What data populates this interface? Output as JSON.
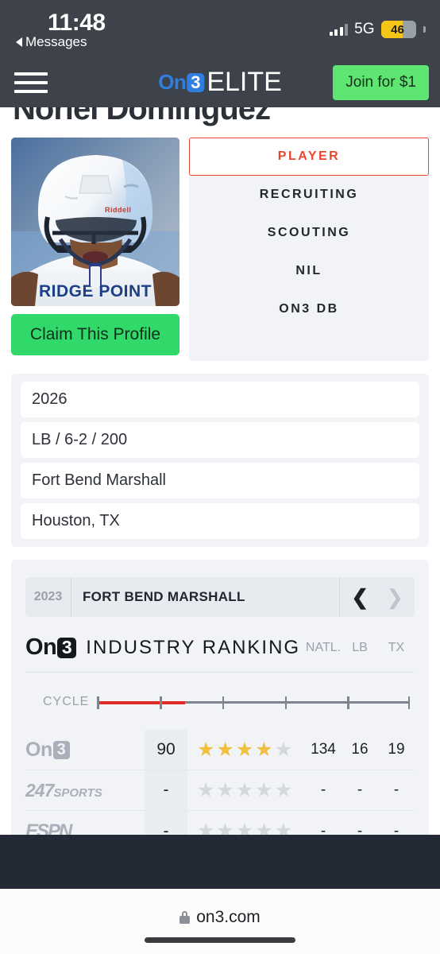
{
  "status_bar": {
    "time": "11:48",
    "back_label": "Messages",
    "network": "5G",
    "battery_level": "46"
  },
  "site_header": {
    "brand_on": "On",
    "brand_three": "3",
    "brand_elite": "ELITE",
    "join_label": "Join for $1",
    "menu_icon": "hamburger-menu-icon"
  },
  "player": {
    "name": "Noriel Dominguez",
    "claim_label": "Claim This Profile",
    "photo_alt": "player-helmet-photo",
    "jersey_text": "RIDGE POINT",
    "helmet_brand": "Riddell"
  },
  "nav_tabs": [
    {
      "label": "PLAYER",
      "active": true
    },
    {
      "label": "RECRUITING",
      "active": false
    },
    {
      "label": "SCOUTING",
      "active": false
    },
    {
      "label": "NIL",
      "active": false
    },
    {
      "label": "ON3 DB",
      "active": false
    }
  ],
  "info_rows": [
    "2026",
    "LB / 6-2 / 200",
    "Fort Bend Marshall",
    "Houston, TX"
  ],
  "ranking": {
    "year": "2023",
    "team": "FORT BEND MARSHALL",
    "prev_icon": "chevron-left-icon",
    "next_icon": "chevron-right-icon",
    "prev_enabled": true,
    "next_enabled": false,
    "title_on": "On",
    "title_three": "3",
    "title_text": "INDUSTRY RANKING",
    "columns": [
      "NATL.",
      "LB",
      "TX"
    ],
    "cycle_label": "CYCLE",
    "cycle_progress_pct": 28,
    "cycle_ticks": 6,
    "rows": [
      {
        "source": "On3",
        "source_logo": "on3-logo",
        "score": "90",
        "stars_filled": 4,
        "stars_total": 5,
        "natl": "134",
        "pos": "16",
        "state": "19"
      },
      {
        "source": "247Sports",
        "source_logo": "247sports-logo",
        "score": "-",
        "stars_filled": 0,
        "stars_total": 5,
        "natl": "-",
        "pos": "-",
        "state": "-"
      },
      {
        "source": "ESPN",
        "source_logo": "espn-logo",
        "score": "-",
        "stars_filled": 0,
        "stars_total": 5,
        "natl": "-",
        "pos": "-",
        "state": "-"
      }
    ]
  },
  "browser": {
    "url": "on3.com",
    "lock_icon": "lock-icon"
  },
  "colors": {
    "header_bg": "#3d424b",
    "accent_red": "#e8462c",
    "join_green": "#5ee572",
    "claim_green": "#31d96a",
    "brand_blue": "#2f7fe0",
    "star_gold": "#f0c03e",
    "cycle_red": "#e02b29",
    "battery_yellow": "#f5c518",
    "panel_gray": "#f1f3f6"
  }
}
